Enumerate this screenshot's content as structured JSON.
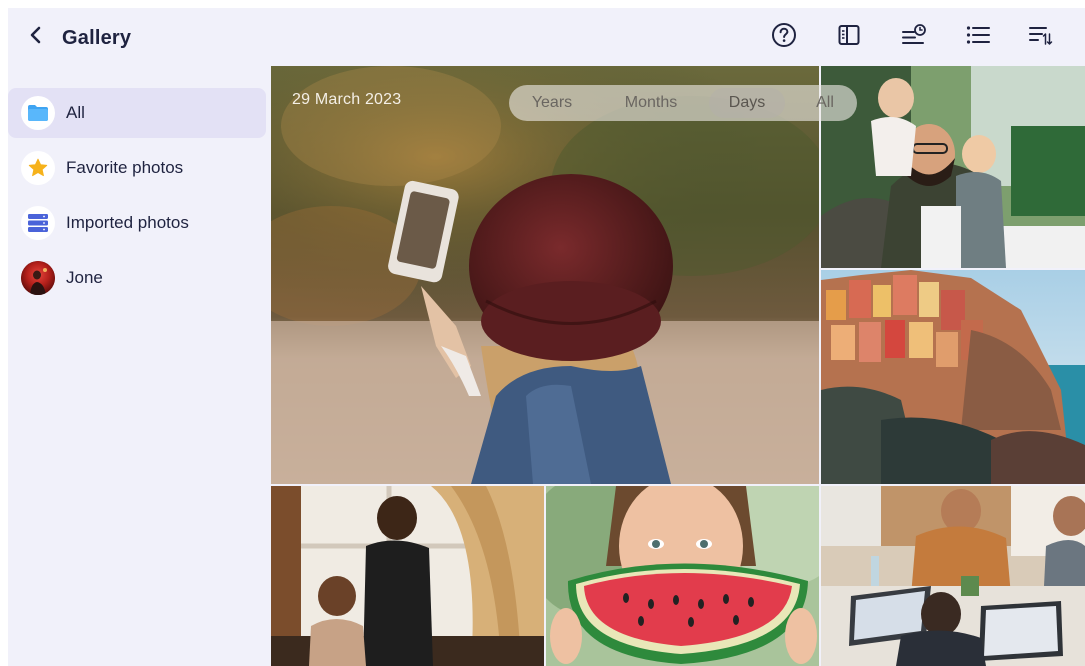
{
  "header": {
    "title": "Gallery",
    "back_icon": "chevron-left-icon",
    "actions": [
      "help-icon",
      "sidebar-toggle-icon",
      "timeline-icon",
      "list-view-icon",
      "sort-icon"
    ]
  },
  "sidebar": {
    "items": [
      {
        "label": "All",
        "icon": "folder-icon",
        "active": true
      },
      {
        "label": "Favorite photos",
        "icon": "star-icon",
        "active": false
      },
      {
        "label": "Imported photos",
        "icon": "storage-icon",
        "active": false
      },
      {
        "label": "Jone",
        "icon": "avatar",
        "active": false
      }
    ]
  },
  "gallery": {
    "date": "29 March 2023",
    "view_modes": [
      "Years",
      "Months",
      "Days",
      "All"
    ],
    "selected_view": "Days"
  },
  "colors": {
    "accent_folder": "#3fa4f2",
    "accent_star": "#f6b21b",
    "accent_storage": "#4a63d9",
    "active_bg": "#e3e1f5",
    "background": "#f1f1fa"
  }
}
